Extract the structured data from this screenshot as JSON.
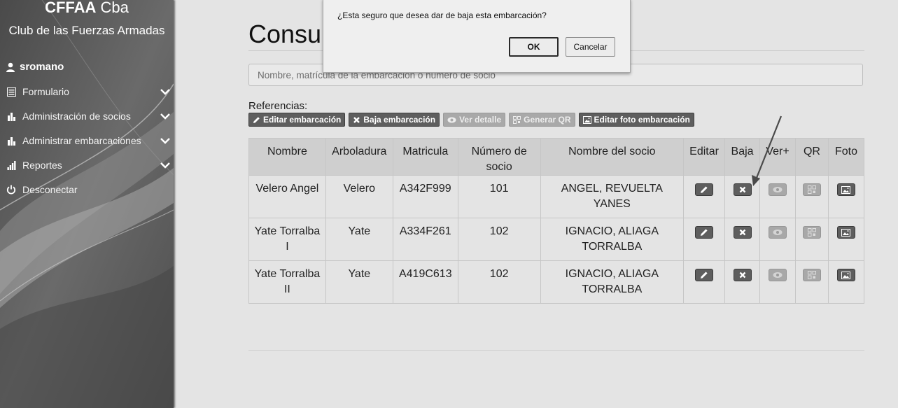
{
  "sidebar": {
    "brand_strong": "CFFAA",
    "brand_rest": " Cba",
    "subtitle": "Club de las Fuerzas Armadas",
    "username": "sromano",
    "items": [
      {
        "label": "Formulario",
        "icon": "list-icon"
      },
      {
        "label": "Administración de socios",
        "icon": "bar-chart-icon"
      },
      {
        "label": "Administrar embarcaciones",
        "icon": "bar-chart-icon"
      },
      {
        "label": "Reportes",
        "icon": "signal-icon"
      },
      {
        "label": "Desconectar",
        "icon": "power-icon"
      }
    ]
  },
  "main": {
    "title": "Consu",
    "search_placeholder": "Nombre, matrícula de la embarcación o número de socio",
    "refs_label": "Referencias:",
    "refs": [
      {
        "label": "Editar embarcación",
        "icon": "pencil-icon",
        "enabled": true
      },
      {
        "label": "Baja embarcación",
        "icon": "x-icon",
        "enabled": true
      },
      {
        "label": "Ver detalle",
        "icon": "eye-icon",
        "enabled": false
      },
      {
        "label": "Generar QR",
        "icon": "qr-icon",
        "enabled": false
      },
      {
        "label": "Editar foto embarcación",
        "icon": "image-icon",
        "enabled": true
      }
    ]
  },
  "table": {
    "headers": [
      "Nombre",
      "Arboladura",
      "Matricula",
      "Número de socio",
      "Nombre del socio",
      "Editar",
      "Baja",
      "Ver+",
      "QR",
      "Foto"
    ],
    "rows": [
      {
        "nombre": "Velero Angel",
        "arboladura": "Velero",
        "matricula": "A342F999",
        "numero": "101",
        "socio": "ANGEL, REVUELTA YANES"
      },
      {
        "nombre": "Yate Torralba I",
        "arboladura": "Yate",
        "matricula": "A334F261",
        "numero": "102",
        "socio": "IGNACIO, ALIAGA TORRALBA"
      },
      {
        "nombre": "Yate Torralba II",
        "arboladura": "Yate",
        "matricula": "A419C613",
        "numero": "102",
        "socio": "IGNACIO, ALIAGA TORRALBA"
      }
    ]
  },
  "dialog": {
    "message": "¿Esta seguro que desea dar de baja esta embarcación?",
    "ok_label": "OK",
    "cancel_label": "Cancelar"
  },
  "colors": {
    "sidebar_bg": "#5a5a5a",
    "page_bg": "#e4e4e4",
    "button_dark": "#5e5e5e",
    "button_disabled": "#a9a9a9"
  }
}
